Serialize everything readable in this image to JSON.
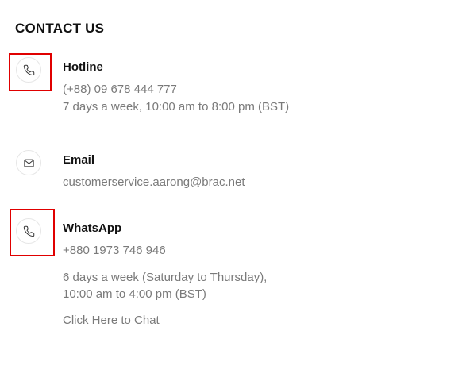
{
  "section": {
    "title": "CONTACT US"
  },
  "hotline": {
    "title": "Hotline",
    "phone": "(+88) 09 678 444 777",
    "hours": "7 days a week, 10:00 am to 8:00 pm (BST)",
    "icon": "phone-icon"
  },
  "email": {
    "title": "Email",
    "address": "customerservice.aarong@brac.net",
    "icon": "mail-icon"
  },
  "whatsapp": {
    "title": "WhatsApp",
    "phone": "+880 1973 746 946",
    "hours_line1": "6 days a week (Saturday to Thursday),",
    "hours_line2": "10:00 am to 4:00 pm (BST)",
    "chat_link": "Click Here to Chat",
    "icon": "phone-icon"
  },
  "colors": {
    "highlight": "#e00000",
    "muted_text": "#7a7a7a"
  }
}
